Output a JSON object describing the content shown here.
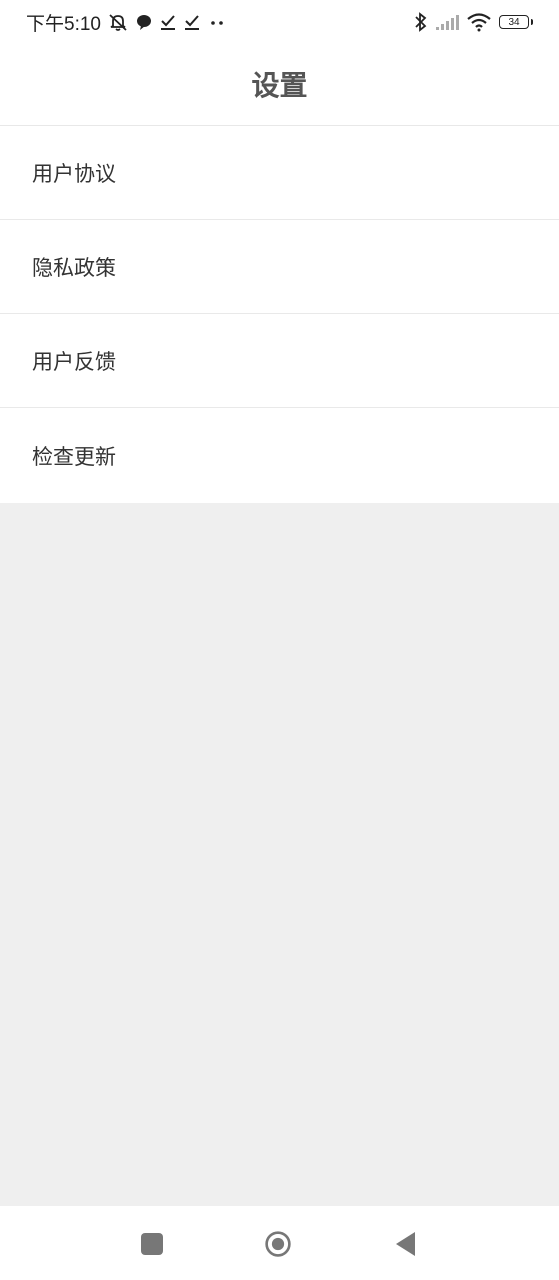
{
  "status_bar": {
    "time": "下午5:10",
    "battery": "34",
    "icons_left": [
      "mute-notification-icon",
      "chat-bubble-icon",
      "download-check-icon",
      "download-check-icon",
      "more-dots-icon"
    ],
    "icons_right": [
      "bluetooth-icon",
      "signal-icon",
      "wifi-icon",
      "battery-icon"
    ]
  },
  "header": {
    "title": "设置"
  },
  "settings": {
    "items": [
      {
        "label": "用户协议"
      },
      {
        "label": "隐私政策"
      },
      {
        "label": "用户反馈"
      },
      {
        "label": "检查更新"
      }
    ]
  },
  "nav_bar": {
    "buttons": [
      "recents-square-icon",
      "home-circle-icon",
      "back-triangle-icon"
    ]
  },
  "colors": {
    "background": "#efefef",
    "surface": "#ffffff",
    "title_text": "#555555",
    "item_text": "#333333",
    "divider": "#e9e9e9",
    "nav_icon": "#777777"
  }
}
